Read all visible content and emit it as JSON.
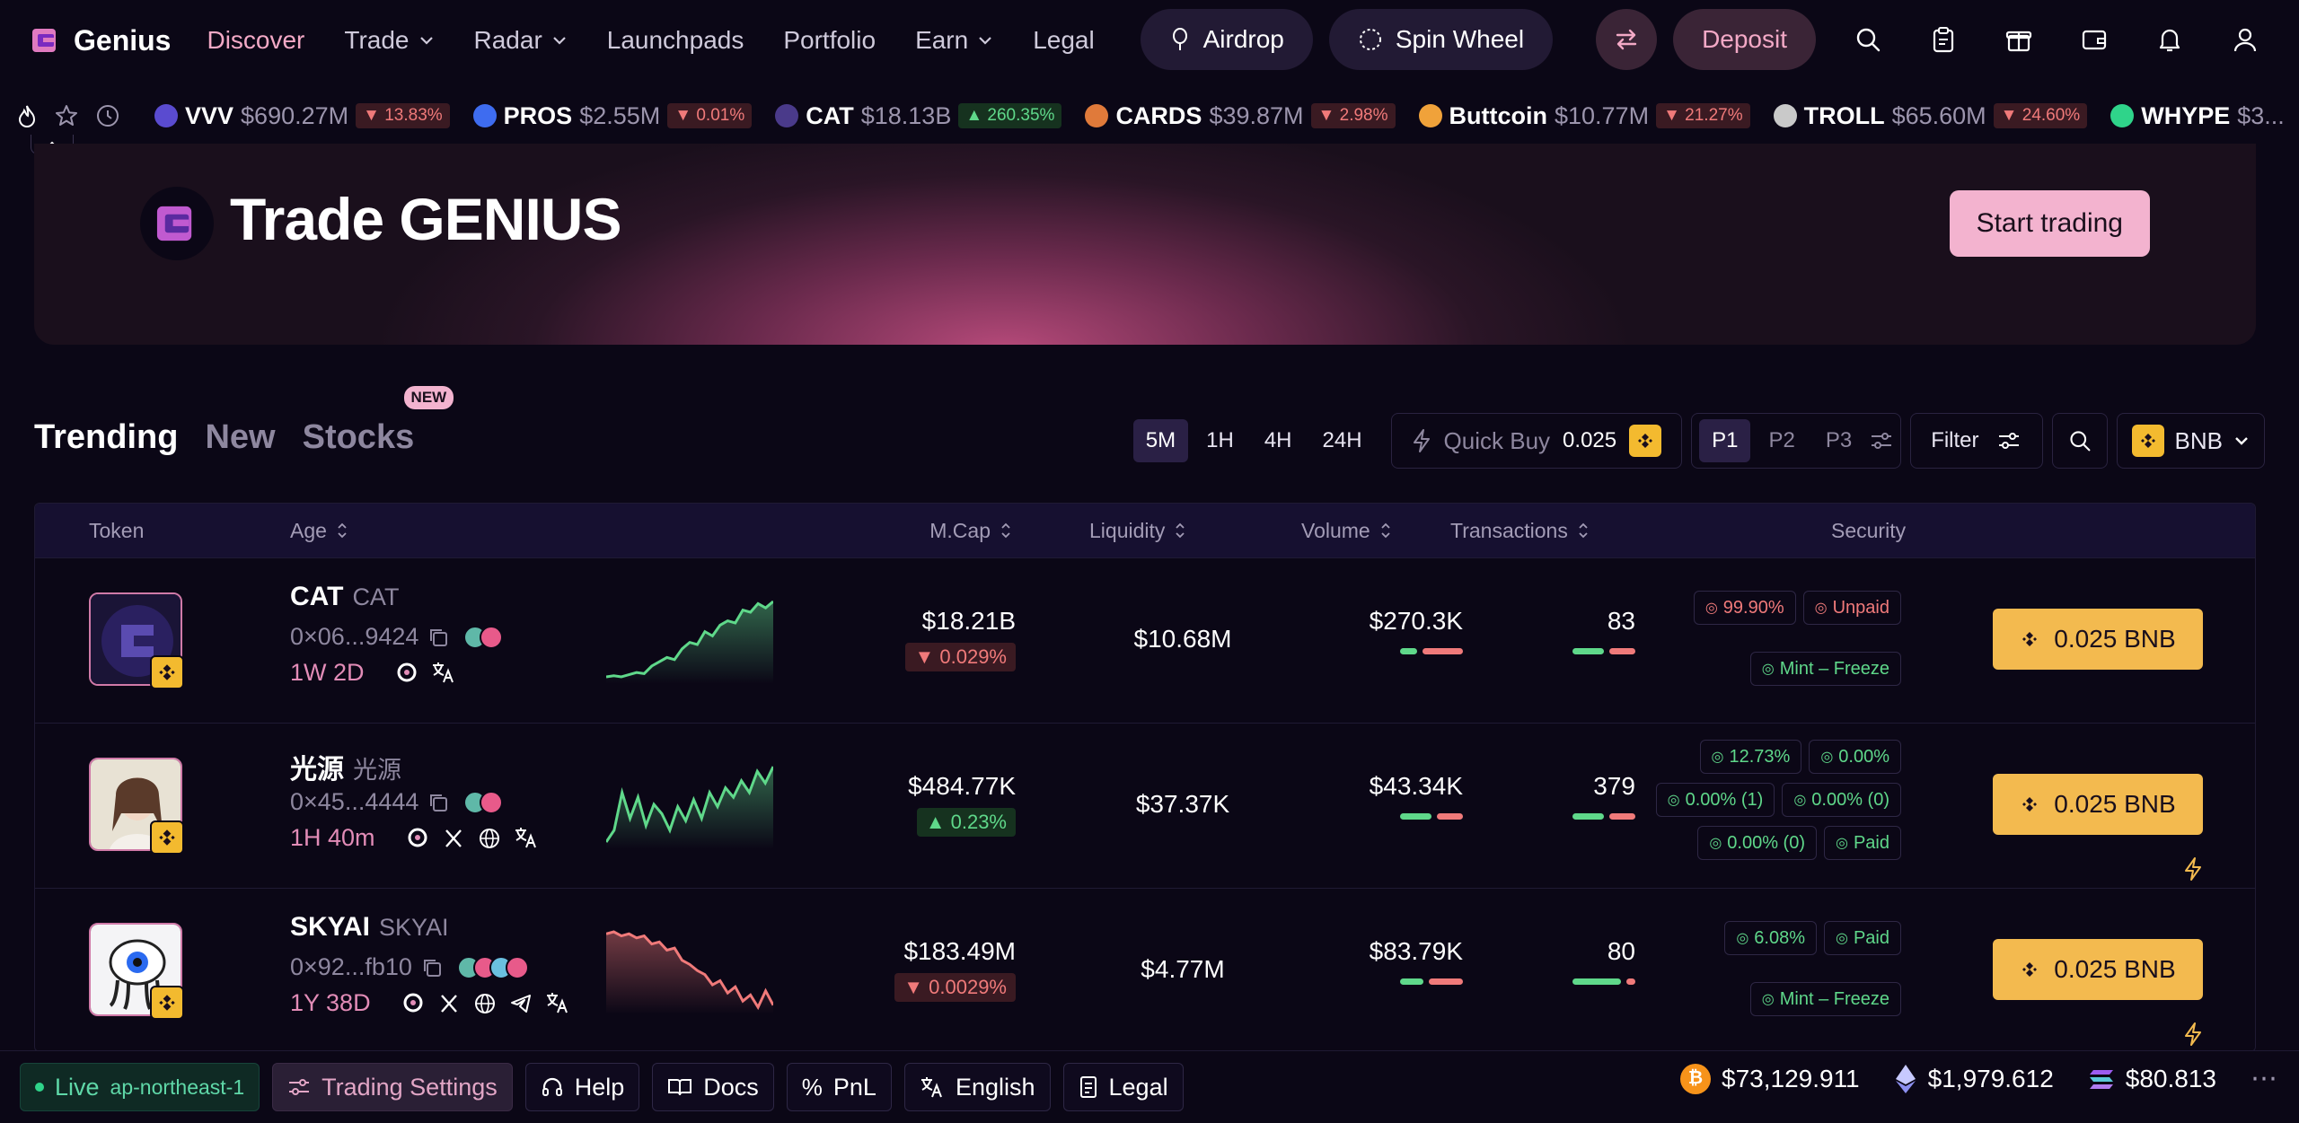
{
  "nav": {
    "brand": "Genius",
    "links": [
      {
        "label": "Discover",
        "active": true,
        "dropdown": false
      },
      {
        "label": "Trade",
        "dropdown": true
      },
      {
        "label": "Radar",
        "dropdown": true
      },
      {
        "label": "Launchpads",
        "dropdown": false
      },
      {
        "label": "Portfolio",
        "dropdown": false
      },
      {
        "label": "Earn",
        "dropdown": true
      },
      {
        "label": "Legal",
        "dropdown": false
      }
    ],
    "airdrop": "Airdrop",
    "spin_wheel": "Spin Wheel",
    "deposit": "Deposit"
  },
  "ticker": [
    {
      "sym": "VVV",
      "cap": "$690.27M",
      "chg": "13.83%",
      "dir": "down",
      "color": "#5a4bd0"
    },
    {
      "sym": "PROS",
      "cap": "$2.55M",
      "chg": "0.01%",
      "dir": "down",
      "color": "#3e6cf0"
    },
    {
      "sym": "CAT",
      "cap": "$18.13B",
      "chg": "260.35%",
      "dir": "up",
      "color": "#4a3a8a"
    },
    {
      "sym": "CARDS",
      "cap": "$39.87M",
      "chg": "2.98%",
      "dir": "down",
      "color": "#e07a3a"
    },
    {
      "sym": "Buttcoin",
      "cap": "$10.77M",
      "chg": "21.27%",
      "dir": "down",
      "color": "#f0a23a"
    },
    {
      "sym": "TROLL",
      "cap": "$65.60M",
      "chg": "24.60%",
      "dir": "down",
      "color": "#c9c9c9"
    },
    {
      "sym": "WHYPE",
      "cap": "$3...",
      "chg": "",
      "dir": "up",
      "color": "#2fd48a"
    }
  ],
  "banner": {
    "title": "Trade GENIUS",
    "cta": "Start trading"
  },
  "tabs": {
    "trending": "Trending",
    "new": "New",
    "stocks": "Stocks",
    "new_badge": "NEW"
  },
  "toolbar": {
    "timeframes": [
      "5M",
      "1H",
      "4H",
      "24H"
    ],
    "selected_timeframe": "5M",
    "quick_buy_label": "Quick Buy",
    "quick_buy_value": "0.025",
    "presets": [
      "P1",
      "P2",
      "P3"
    ],
    "selected_preset": "P1",
    "filter": "Filter",
    "chain": "BNB"
  },
  "table": {
    "headers": {
      "token": "Token",
      "age": "Age",
      "mcap": "M.Cap",
      "liquidity": "Liquidity",
      "volume": "Volume",
      "transactions": "Transactions",
      "security": "Security"
    },
    "rows": [
      {
        "name": "CAT",
        "ticker": "CAT",
        "addr": "0×06...9424",
        "age": "1W 2D",
        "mcap": "$18.21B",
        "mcap_chg": "0.029%",
        "mcap_dir": "down",
        "liquidity": "$10.68M",
        "volume": "$270.3K",
        "tx": "83",
        "vol_buy": 0.3,
        "tx_buy": 0.55,
        "security": [
          [
            "99.90%",
            "Unpaid"
          ],
          [
            "Mint – Freeze"
          ]
        ],
        "sec_styles": [
          [
            "red",
            "red"
          ],
          [
            "green"
          ]
        ],
        "buy": "0.025 BNB",
        "spark": [
          10,
          11,
          10,
          12,
          14,
          13,
          20,
          24,
          28,
          26,
          36,
          42,
          40,
          52,
          48,
          58,
          62,
          60,
          72,
          70,
          78,
          74,
          80
        ],
        "spark_color": "#5fd88a",
        "socials": [
          "search",
          "translate"
        ],
        "bolt": false
      },
      {
        "name": "光源",
        "ticker": "光源",
        "addr": "0×45...4444",
        "age": "1H 40m",
        "mcap": "$484.77K",
        "mcap_chg": "0.23%",
        "mcap_dir": "up",
        "liquidity": "$37.37K",
        "volume": "$43.34K",
        "tx": "379",
        "vol_buy": 0.55,
        "tx_buy": 0.55,
        "security": [
          [
            "12.73%",
            "0.00%"
          ],
          [
            "0.00% (1)",
            "0.00% (0)"
          ],
          [
            "0.00% (0)",
            "Paid"
          ]
        ],
        "sec_styles": [
          [
            "green",
            "green"
          ],
          [
            "green",
            "green"
          ],
          [
            "green",
            "green"
          ]
        ],
        "buy": "0.025 BNB",
        "spark": [
          20,
          30,
          62,
          40,
          58,
          34,
          52,
          44,
          30,
          50,
          38,
          56,
          40,
          62,
          50,
          66,
          58,
          72,
          62,
          80,
          70,
          84
        ],
        "spark_color": "#5fd88a",
        "socials": [
          "search",
          "x",
          "web",
          "translate"
        ],
        "bolt": true
      },
      {
        "name": "SKYAI",
        "ticker": "SKYAI",
        "addr": "0×92...fb10",
        "age": "1Y 38D",
        "mcap": "$183.49M",
        "mcap_chg": "0.0029%",
        "mcap_dir": "down",
        "liquidity": "$4.77M",
        "volume": "$83.79K",
        "tx": "80",
        "vol_buy": 0.4,
        "tx_buy": 0.85,
        "security": [
          [
            "6.08%",
            "Paid"
          ],
          [
            "Mint – Freeze"
          ]
        ],
        "sec_styles": [
          [
            "green",
            "green"
          ],
          [
            "green"
          ]
        ],
        "buy": "0.025 BNB",
        "spark": [
          80,
          82,
          78,
          80,
          76,
          78,
          70,
          72,
          64,
          66,
          54,
          50,
          44,
          40,
          30,
          34,
          22,
          28,
          14,
          20,
          8,
          24,
          10
        ],
        "spark_color": "#f07a7a",
        "socials": [
          "search",
          "x",
          "web",
          "telegram",
          "translate"
        ],
        "bolt": true
      }
    ]
  },
  "footer": {
    "live": "Live",
    "region": "ap-northeast-1",
    "trading_settings": "Trading Settings",
    "help": "Help",
    "docs": "Docs",
    "pnl": "PnL",
    "language": "English",
    "legal": "Legal",
    "btc": "$73,129.911",
    "eth": "$1,979.612",
    "sol": "$80.813"
  },
  "colors": {
    "accent": "#f3a9c6",
    "buy": "#f3ba4f",
    "up": "#5fd88a",
    "down": "#f07a7a",
    "bnb": "#f3ba2f"
  }
}
